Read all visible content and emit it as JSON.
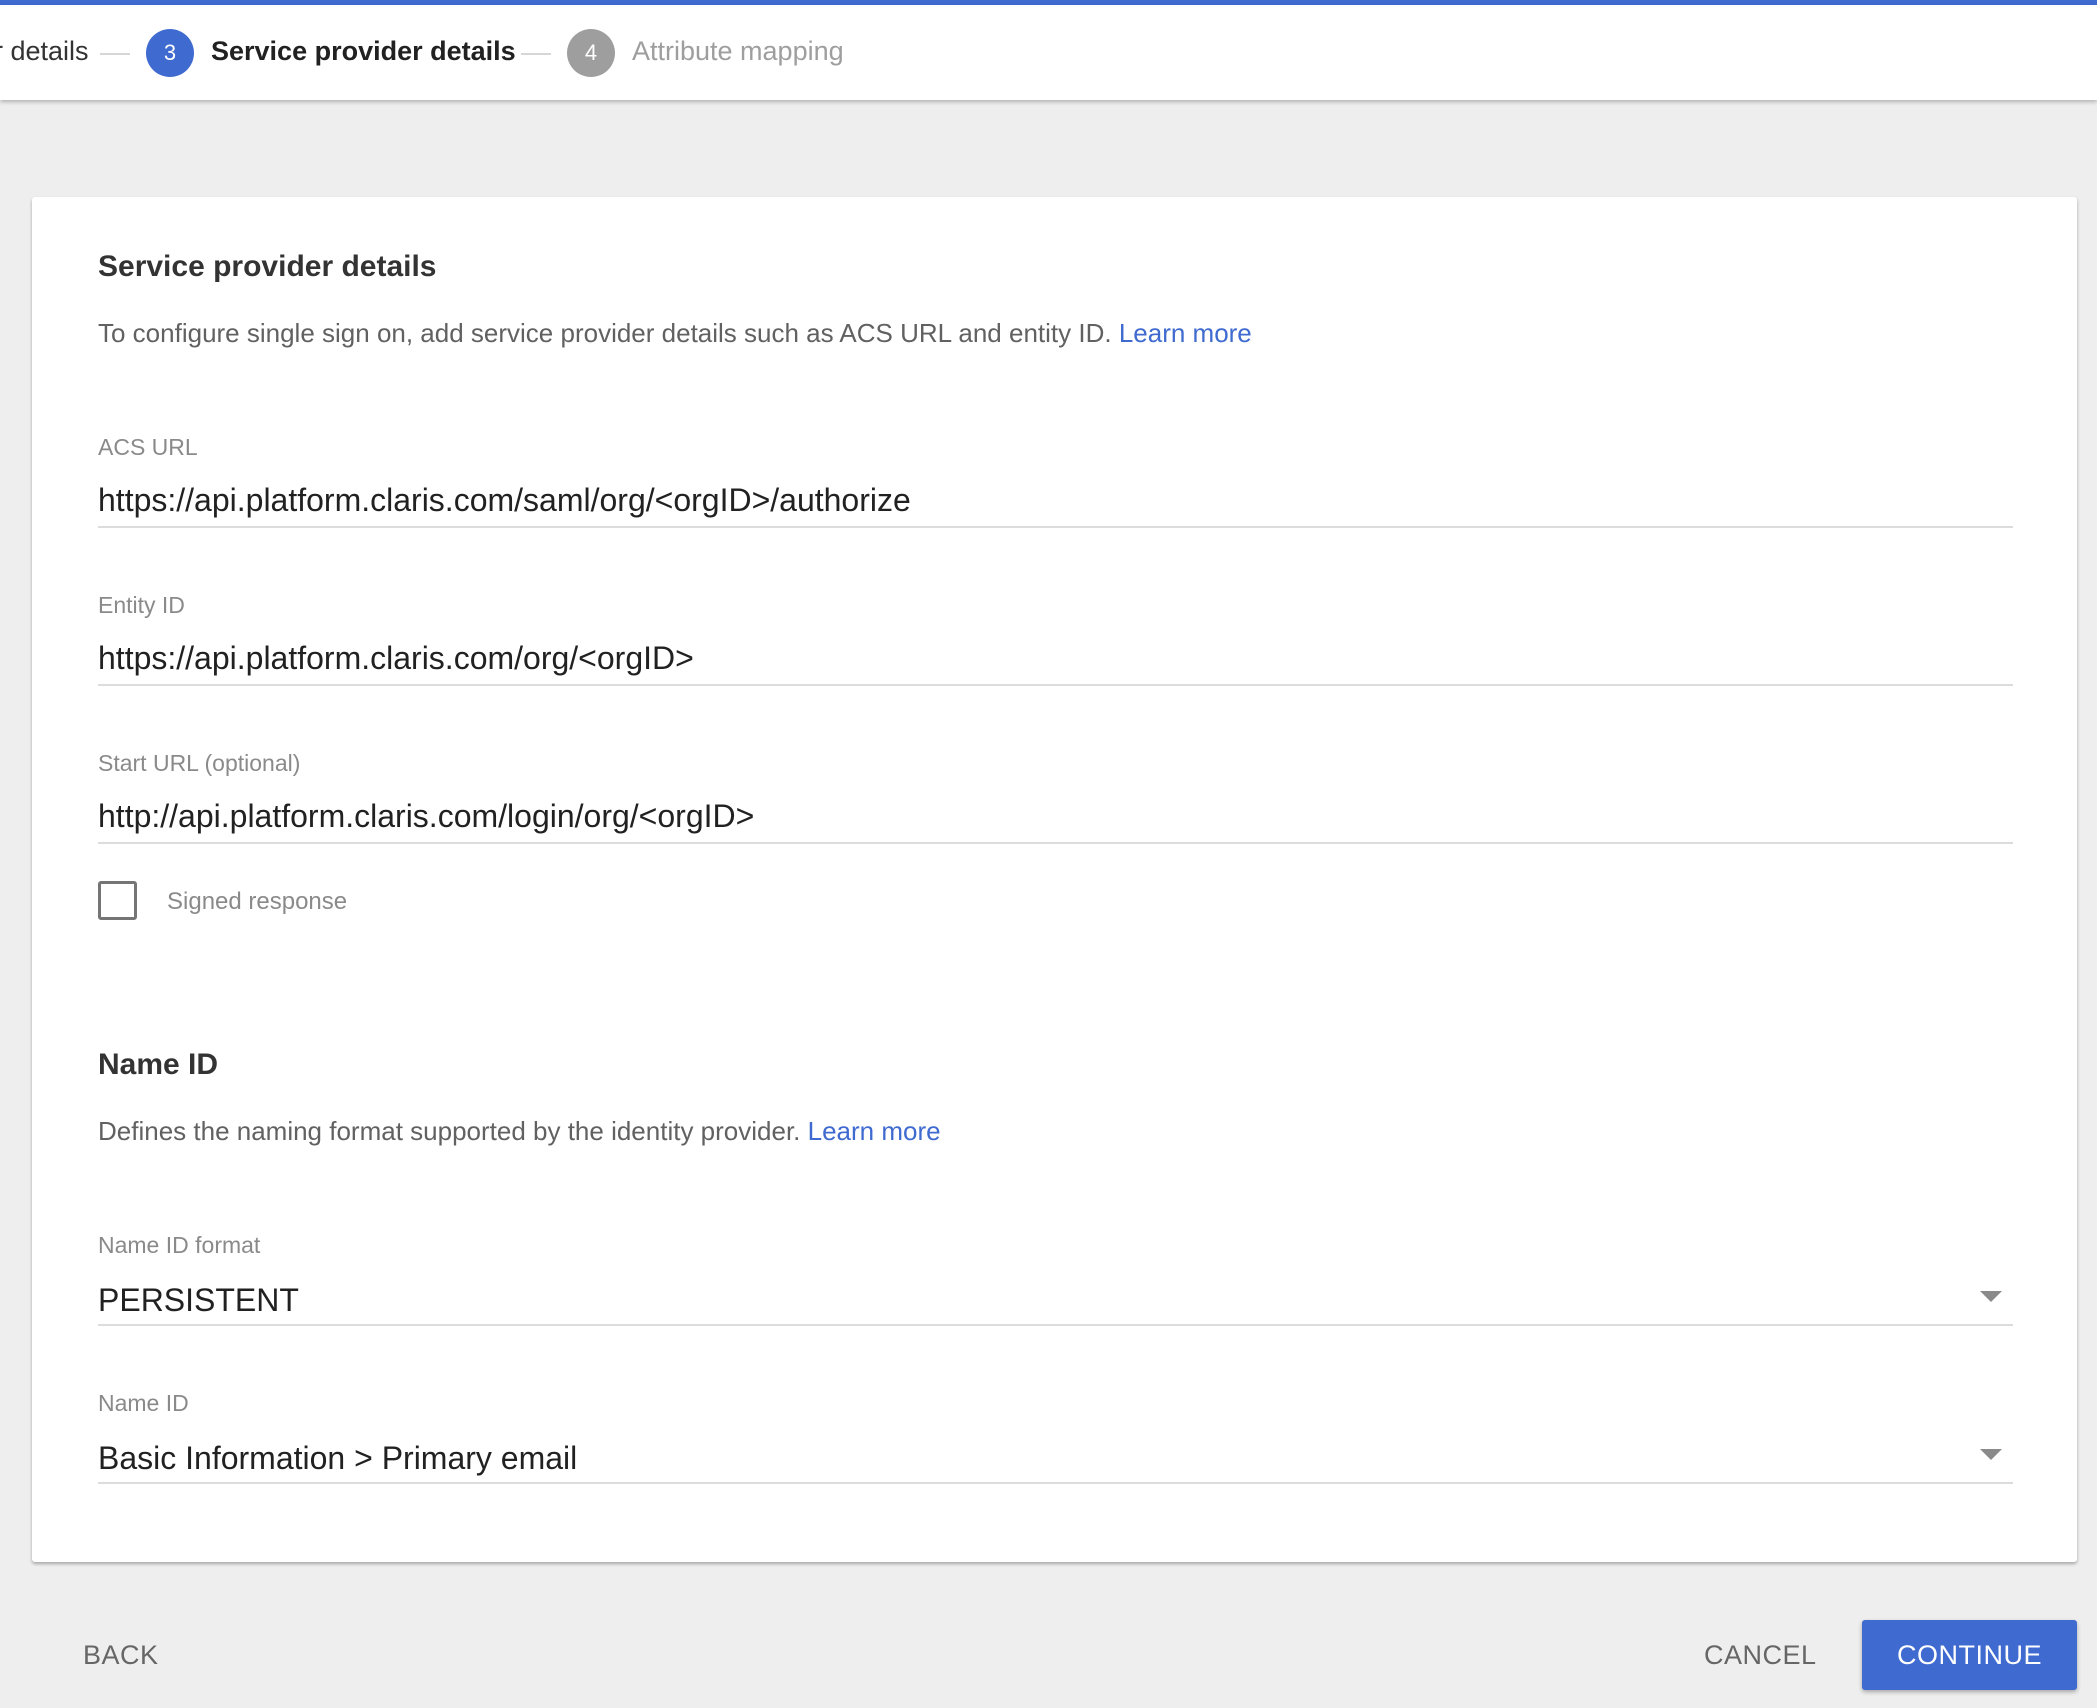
{
  "stepper": {
    "prev_label": "r details",
    "current_number": "3",
    "current_label": "Service provider details",
    "next_number": "4",
    "next_label": "Attribute mapping"
  },
  "colors": {
    "accent": "#3f6ad0",
    "inactive": "#9e9e9e"
  },
  "sp": {
    "title": "Service provider details",
    "description": "To configure single sign on, add service provider details such as ACS URL and entity ID.",
    "learn_more": "Learn more",
    "acs_label": "ACS URL",
    "acs_value": "https://api.platform.claris.com/saml/org/<orgID>/authorize",
    "entity_label": "Entity ID",
    "entity_value": "https://api.platform.claris.com/org/<orgID>",
    "start_label": "Start URL (optional)",
    "start_value": "http://api.platform.claris.com/login/org/<orgID>",
    "signed_label": "Signed response",
    "signed_checked": false
  },
  "nameid": {
    "title": "Name ID",
    "description": "Defines the naming format supported by the identity provider.",
    "learn_more": "Learn more",
    "format_label": "Name ID format",
    "format_value": "PERSISTENT",
    "nameid_label": "Name ID",
    "nameid_value": "Basic Information > Primary email"
  },
  "footer": {
    "back": "BACK",
    "cancel": "CANCEL",
    "continue": "CONTINUE"
  }
}
